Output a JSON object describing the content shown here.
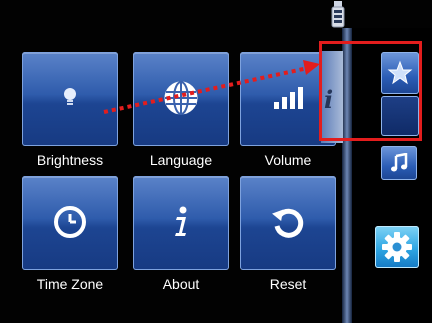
{
  "status": {
    "icon": "usb-plug-icon"
  },
  "tiles": [
    {
      "label": "Brightness",
      "icon": "bulb-icon"
    },
    {
      "label": "Language",
      "icon": "globe-icon"
    },
    {
      "label": "Volume",
      "icon": "volume-bars-icon"
    },
    {
      "label": "Time Zone",
      "icon": "clock-icon"
    },
    {
      "label": "About",
      "icon": "info-icon"
    },
    {
      "label": "Reset",
      "icon": "undo-icon"
    }
  ],
  "side": {
    "info_letter": "i",
    "buttons": [
      {
        "icon": "star-icon"
      },
      {
        "icon": "music-note-icon"
      },
      {
        "icon": "gear-icon"
      }
    ]
  },
  "annotation": {
    "color": "#e31d1d"
  },
  "colors": {
    "tile": "#2f5cac",
    "background": "#020202",
    "accent": "#e31d1d"
  }
}
